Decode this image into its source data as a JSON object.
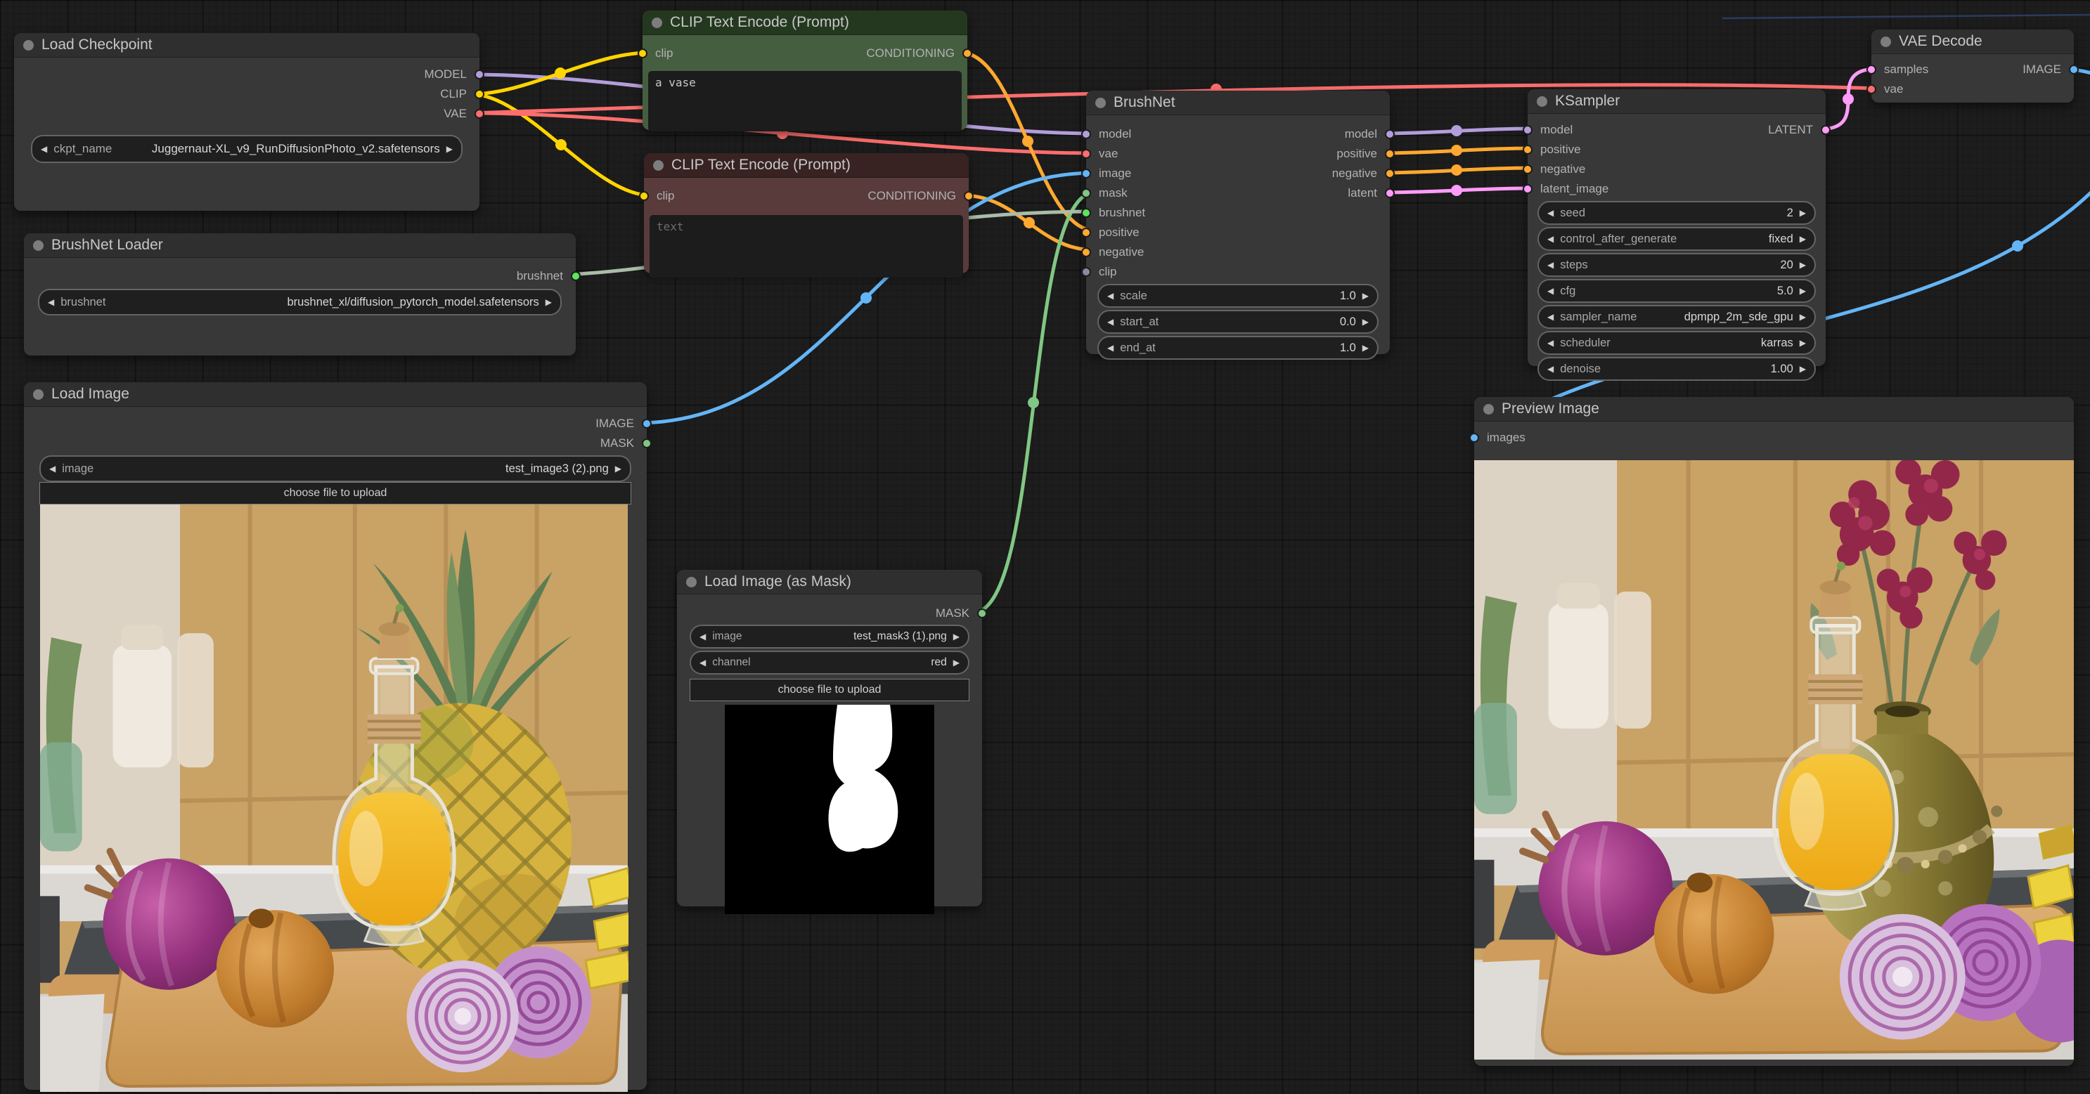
{
  "ui": {
    "arrow_left": "◀",
    "arrow_right": "▶"
  },
  "port_colors": {
    "model": "#B39DDB",
    "clip": "#FFD500",
    "vae": "#FF6E6E",
    "conditioning": "#FFA931",
    "image": "#64B5F6",
    "mask": "#81C784",
    "brushnet": "#5CE65C",
    "brushnet_wire": "#A9BDA9",
    "latent": "#FF9CF9",
    "clip_unused": "#8D89A0"
  },
  "nodes": {
    "load_checkpoint": {
      "title": "Load Checkpoint",
      "outputs": [
        {
          "label": "MODEL"
        },
        {
          "label": "CLIP"
        },
        {
          "label": "VAE"
        }
      ],
      "widgets": [
        {
          "name": "ckpt_name",
          "value": "Juggernaut-XL_v9_RunDiffusionPhoto_v2.safetensors"
        }
      ]
    },
    "clip_text_encode_positive": {
      "title": "CLIP Text Encode (Prompt)",
      "inputs": [
        {
          "label": "clip"
        }
      ],
      "outputs": [
        {
          "label": "CONDITIONING"
        }
      ],
      "prompt": "a vase"
    },
    "clip_text_encode_negative": {
      "title": "CLIP Text Encode (Prompt)",
      "inputs": [
        {
          "label": "clip"
        }
      ],
      "outputs": [
        {
          "label": "CONDITIONING"
        }
      ],
      "placeholder": "text"
    },
    "brushnet_loader": {
      "title": "BrushNet Loader",
      "outputs": [
        {
          "label": "brushnet"
        }
      ],
      "widgets": [
        {
          "name": "brushnet",
          "value": "brushnet_xl/diffusion_pytorch_model.safetensors"
        }
      ]
    },
    "load_image": {
      "title": "Load Image",
      "outputs": [
        {
          "label": "IMAGE"
        },
        {
          "label": "MASK"
        }
      ],
      "widgets": [
        {
          "name": "image",
          "value": "test_image3 (2).png"
        }
      ],
      "button": "choose file to upload"
    },
    "load_image_mask": {
      "title": "Load Image (as Mask)",
      "outputs": [
        {
          "label": "MASK"
        }
      ],
      "widgets": [
        {
          "name": "image",
          "value": "test_mask3 (1).png"
        },
        {
          "name": "channel",
          "value": "red"
        }
      ],
      "button": "choose file to upload"
    },
    "brushnet": {
      "title": "BrushNet",
      "inputs": [
        {
          "label": "model"
        },
        {
          "label": "vae"
        },
        {
          "label": "image"
        },
        {
          "label": "mask"
        },
        {
          "label": "brushnet"
        },
        {
          "label": "positive"
        },
        {
          "label": "negative"
        },
        {
          "label": "clip"
        }
      ],
      "outputs": [
        {
          "label": "model"
        },
        {
          "label": "positive"
        },
        {
          "label": "negative"
        },
        {
          "label": "latent"
        }
      ],
      "widgets": [
        {
          "name": "scale",
          "value": "1.0"
        },
        {
          "name": "start_at",
          "value": "0.0"
        },
        {
          "name": "end_at",
          "value": "1.0"
        }
      ]
    },
    "ksampler": {
      "title": "KSampler",
      "inputs": [
        {
          "label": "model"
        },
        {
          "label": "positive"
        },
        {
          "label": "negative"
        },
        {
          "label": "latent_image"
        }
      ],
      "outputs": [
        {
          "label": "LATENT"
        }
      ],
      "widgets": [
        {
          "name": "seed",
          "value": "2"
        },
        {
          "name": "control_after_generate",
          "value": "fixed"
        },
        {
          "name": "steps",
          "value": "20"
        },
        {
          "name": "cfg",
          "value": "5.0"
        },
        {
          "name": "sampler_name",
          "value": "dpmpp_2m_sde_gpu"
        },
        {
          "name": "scheduler",
          "value": "karras"
        },
        {
          "name": "denoise",
          "value": "1.00"
        }
      ]
    },
    "vae_decode": {
      "title": "VAE Decode",
      "inputs": [
        {
          "label": "samples"
        },
        {
          "label": "vae"
        }
      ],
      "outputs": [
        {
          "label": "IMAGE"
        }
      ]
    },
    "preview_image": {
      "title": "Preview Image",
      "inputs": [
        {
          "label": "images"
        }
      ]
    }
  },
  "links": [
    {
      "from": "load_checkpoint.MODEL",
      "to": "brushnet.model",
      "type": "model"
    },
    {
      "from": "load_checkpoint.CLIP",
      "to": "clip_text_encode_positive.clip",
      "type": "clip"
    },
    {
      "from": "load_checkpoint.CLIP",
      "to": "clip_text_encode_negative.clip",
      "type": "clip"
    },
    {
      "from": "load_checkpoint.VAE",
      "to": "brushnet.vae",
      "type": "vae"
    },
    {
      "from": "load_checkpoint.VAE",
      "to": "vae_decode.vae",
      "type": "vae"
    },
    {
      "from": "clip_text_encode_positive.CONDITIONING",
      "to": "brushnet.positive",
      "type": "conditioning"
    },
    {
      "from": "clip_text_encode_negative.CONDITIONING",
      "to": "brushnet.negative",
      "type": "conditioning"
    },
    {
      "from": "load_image.IMAGE",
      "to": "brushnet.image",
      "type": "image"
    },
    {
      "from": "load_image_mask.MASK",
      "to": "brushnet.mask",
      "type": "mask"
    },
    {
      "from": "brushnet_loader.brushnet",
      "to": "brushnet.brushnet",
      "type": "brushnet_wire"
    },
    {
      "from": "brushnet.model",
      "to": "ksampler.model",
      "type": "model"
    },
    {
      "from": "brushnet.positive",
      "to": "ksampler.positive",
      "type": "conditioning"
    },
    {
      "from": "brushnet.negative",
      "to": "ksampler.negative",
      "type": "conditioning"
    },
    {
      "from": "brushnet.latent",
      "to": "ksampler.latent_image",
      "type": "latent"
    },
    {
      "from": "ksampler.LATENT",
      "to": "vae_decode.samples",
      "type": "latent"
    },
    {
      "from": "vae_decode.IMAGE",
      "to": "preview_image.images",
      "type": "image"
    }
  ]
}
